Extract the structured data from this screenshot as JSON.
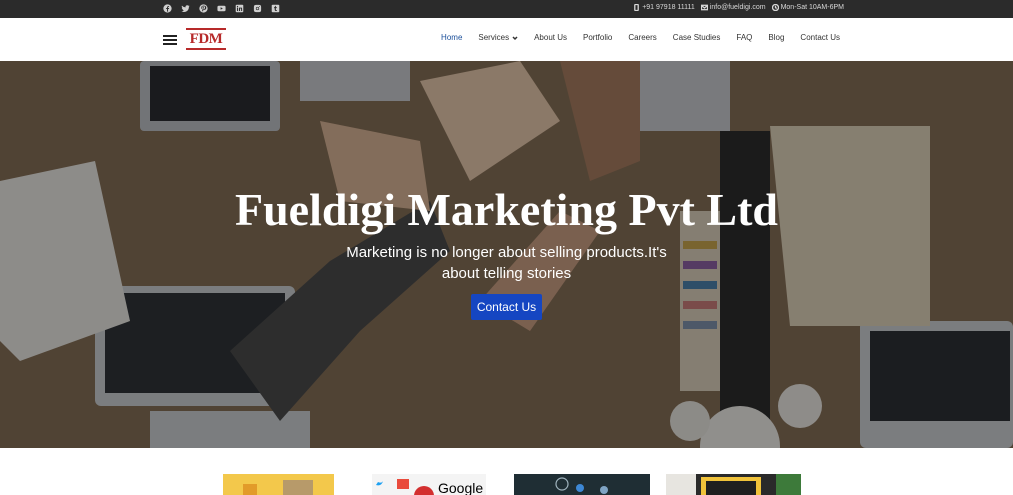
{
  "topbar": {
    "social_icons": [
      "facebook-icon",
      "twitter-icon",
      "pinterest-icon",
      "youtube-icon",
      "linkedin-icon",
      "instagram-icon",
      "tumblr-icon"
    ],
    "phone": "+91 97918 11111",
    "email": "info@fueldigi.com",
    "hours": "Mon-Sat 10AM-6PM"
  },
  "header": {
    "logo_text": "FDM",
    "nav": [
      {
        "label": "Home",
        "active": true
      },
      {
        "label": "Services",
        "has_dropdown": true
      },
      {
        "label": "About Us"
      },
      {
        "label": "Portfolio"
      },
      {
        "label": "Careers"
      },
      {
        "label": "Case Studies"
      },
      {
        "label": "FAQ"
      },
      {
        "label": "Blog"
      },
      {
        "label": "Contact Us"
      }
    ]
  },
  "hero": {
    "title": "Fueldigi Marketing Pvt Ltd",
    "subtitle": "Marketing is no longer about selling products.It's about telling stories",
    "button_label": "Contact Us",
    "accent_color": "#1546c2"
  },
  "thumbnails": {
    "google_text": "Google"
  }
}
